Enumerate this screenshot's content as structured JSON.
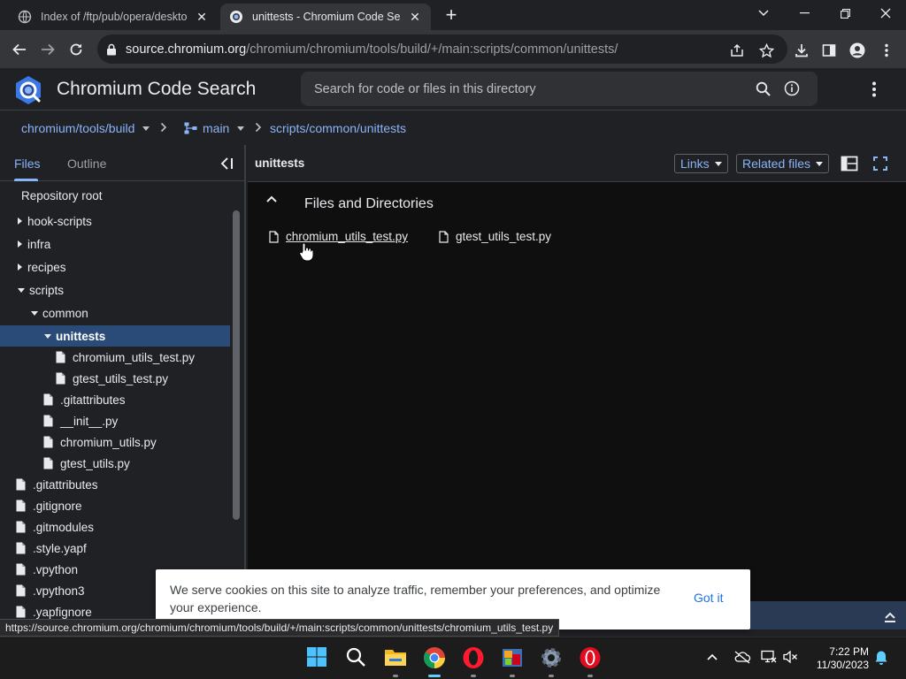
{
  "browser": {
    "tabs": [
      {
        "title": "Index of /ftp/pub/opera/desktop",
        "active": false
      },
      {
        "title": "unittests - Chromium Code Search",
        "active": true
      }
    ],
    "url_host": "source.chromium.org",
    "url_path": "/chromium/chromium/tools/build/+/main:scripts/common/unittests/",
    "status_url": "https://source.chromium.org/chromium/chromium/tools/build/+/main:scripts/common/unittests/chromium_utils_test.py"
  },
  "header": {
    "app_title": "Chromium Code Search",
    "search_placeholder": "Search for code or files in this directory"
  },
  "breadcrumb": {
    "repo": "chromium/tools/build",
    "branch": "main",
    "path": "scripts/common/unittests"
  },
  "sidebar": {
    "tabs": [
      "Files",
      "Outline"
    ],
    "root_label": "Repository root",
    "tree": [
      {
        "label": "hook-scripts",
        "kind": "folder",
        "state": "collapsed",
        "depth": 0
      },
      {
        "label": "infra",
        "kind": "folder",
        "state": "collapsed",
        "depth": 0
      },
      {
        "label": "recipes",
        "kind": "folder",
        "state": "collapsed",
        "depth": 0
      },
      {
        "label": "scripts",
        "kind": "folder",
        "state": "expanded",
        "depth": 0
      },
      {
        "label": "common",
        "kind": "folder",
        "state": "expanded",
        "depth": 1
      },
      {
        "label": "unittests",
        "kind": "folder",
        "state": "expanded",
        "depth": 2,
        "selected": true
      },
      {
        "label": "chromium_utils_test.py",
        "kind": "file",
        "depth": 3
      },
      {
        "label": "gtest_utils_test.py",
        "kind": "file",
        "depth": 3
      },
      {
        "label": ".gitattributes",
        "kind": "file",
        "depth": 2
      },
      {
        "label": "__init__.py",
        "kind": "file",
        "depth": 2
      },
      {
        "label": "chromium_utils.py",
        "kind": "file",
        "depth": 2
      },
      {
        "label": "gtest_utils.py",
        "kind": "file",
        "depth": 2
      },
      {
        "label": ".gitattributes",
        "kind": "file",
        "depth": 0
      },
      {
        "label": ".gitignore",
        "kind": "file",
        "depth": 0
      },
      {
        "label": ".gitmodules",
        "kind": "file",
        "depth": 0
      },
      {
        "label": ".style.yapf",
        "kind": "file",
        "depth": 0
      },
      {
        "label": ".vpython",
        "kind": "file",
        "depth": 0
      },
      {
        "label": ".vpython3",
        "kind": "file",
        "depth": 0
      },
      {
        "label": ".yapfignore",
        "kind": "file",
        "depth": 0
      }
    ]
  },
  "main": {
    "title": "unittests",
    "links_label": "Links",
    "related_label": "Related files",
    "section_title": "Files and Directories",
    "files": [
      "chromium_utils_test.py",
      "gtest_utils_test.py"
    ]
  },
  "cookie": {
    "text": "We serve cookies on this site to analyze traffic, remember your preferences, and optimize your experience.",
    "button": "Got it"
  },
  "taskbar": {
    "time": "7:22 PM",
    "date": "11/30/2023"
  },
  "colors": {
    "link": "#8ab4f8",
    "selected_row": "#2a4a78",
    "accent": "#1a73e8"
  }
}
